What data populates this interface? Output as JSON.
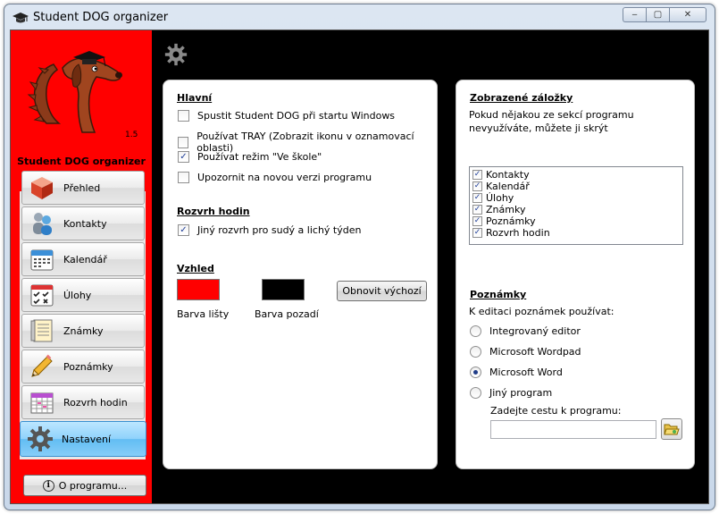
{
  "window": {
    "title": "Student DOG organizer",
    "controls": {
      "minimize": "‒",
      "maximize": "▢",
      "close": "✕"
    }
  },
  "sidebar": {
    "version": "1.5",
    "app_name": "Student DOG organizer",
    "items": [
      {
        "label": "Přehled",
        "icon": "cube-icon"
      },
      {
        "label": "Kontakty",
        "icon": "people-icon"
      },
      {
        "label": "Kalendář",
        "icon": "calendar-icon"
      },
      {
        "label": "Úlohy",
        "icon": "tasks-icon"
      },
      {
        "label": "Známky",
        "icon": "grades-icon"
      },
      {
        "label": "Poznámky",
        "icon": "pencil-icon"
      },
      {
        "label": "Rozvrh hodin",
        "icon": "timetable-icon"
      },
      {
        "label": "Nastavení",
        "icon": "gear-icon",
        "active": true
      }
    ],
    "about_label": "O programu..."
  },
  "general": {
    "title": "Hlavní",
    "options": [
      {
        "label": "Spustit Student DOG při startu Windows",
        "checked": false
      },
      {
        "label": "Používat TRAY (Zobrazit ikonu v oznamovací oblasti)",
        "checked": false
      },
      {
        "label": "Používat režim \"Ve škole\"",
        "checked": true
      },
      {
        "label": "Upozornit na novou verzi programu",
        "checked": false
      }
    ]
  },
  "timetable": {
    "title": "Rozvrh hodin",
    "option": {
      "label": "Jiný rozvrh pro sudý a lichý týden",
      "checked": true
    }
  },
  "appearance": {
    "title": "Vzhled",
    "bar_color": "#ff0000",
    "bar_color_label": "Barva lišty",
    "bg_color": "#000000",
    "bg_color_label": "Barva pozadí",
    "reset_label": "Obnovit výchozí"
  },
  "tabs": {
    "title": "Zobrazené záložky",
    "description": "Pokud nějakou ze sekcí programu nevyužíváte, můžete ji skrýt",
    "items": [
      {
        "label": "Kontakty",
        "checked": true
      },
      {
        "label": "Kalendář",
        "checked": true
      },
      {
        "label": "Úlohy",
        "checked": true
      },
      {
        "label": "Známky",
        "checked": true
      },
      {
        "label": "Poznámky",
        "checked": true
      },
      {
        "label": "Rozvrh hodin",
        "checked": true
      }
    ]
  },
  "notes": {
    "title": "Poznámky",
    "description": "K editaci poznámek používat:",
    "options": [
      {
        "label": "Integrovaný editor",
        "selected": false
      },
      {
        "label": "Microsoft Wordpad",
        "selected": false
      },
      {
        "label": "Microsoft Word",
        "selected": true
      },
      {
        "label": "Jiný program",
        "selected": false
      }
    ],
    "path_label": "Zadejte cestu k programu:",
    "path_value": "",
    "path_placeholder": ""
  },
  "colors": {
    "accent_red": "#ff0000",
    "background": "#000000",
    "active_blue": "#8fd2fb"
  }
}
